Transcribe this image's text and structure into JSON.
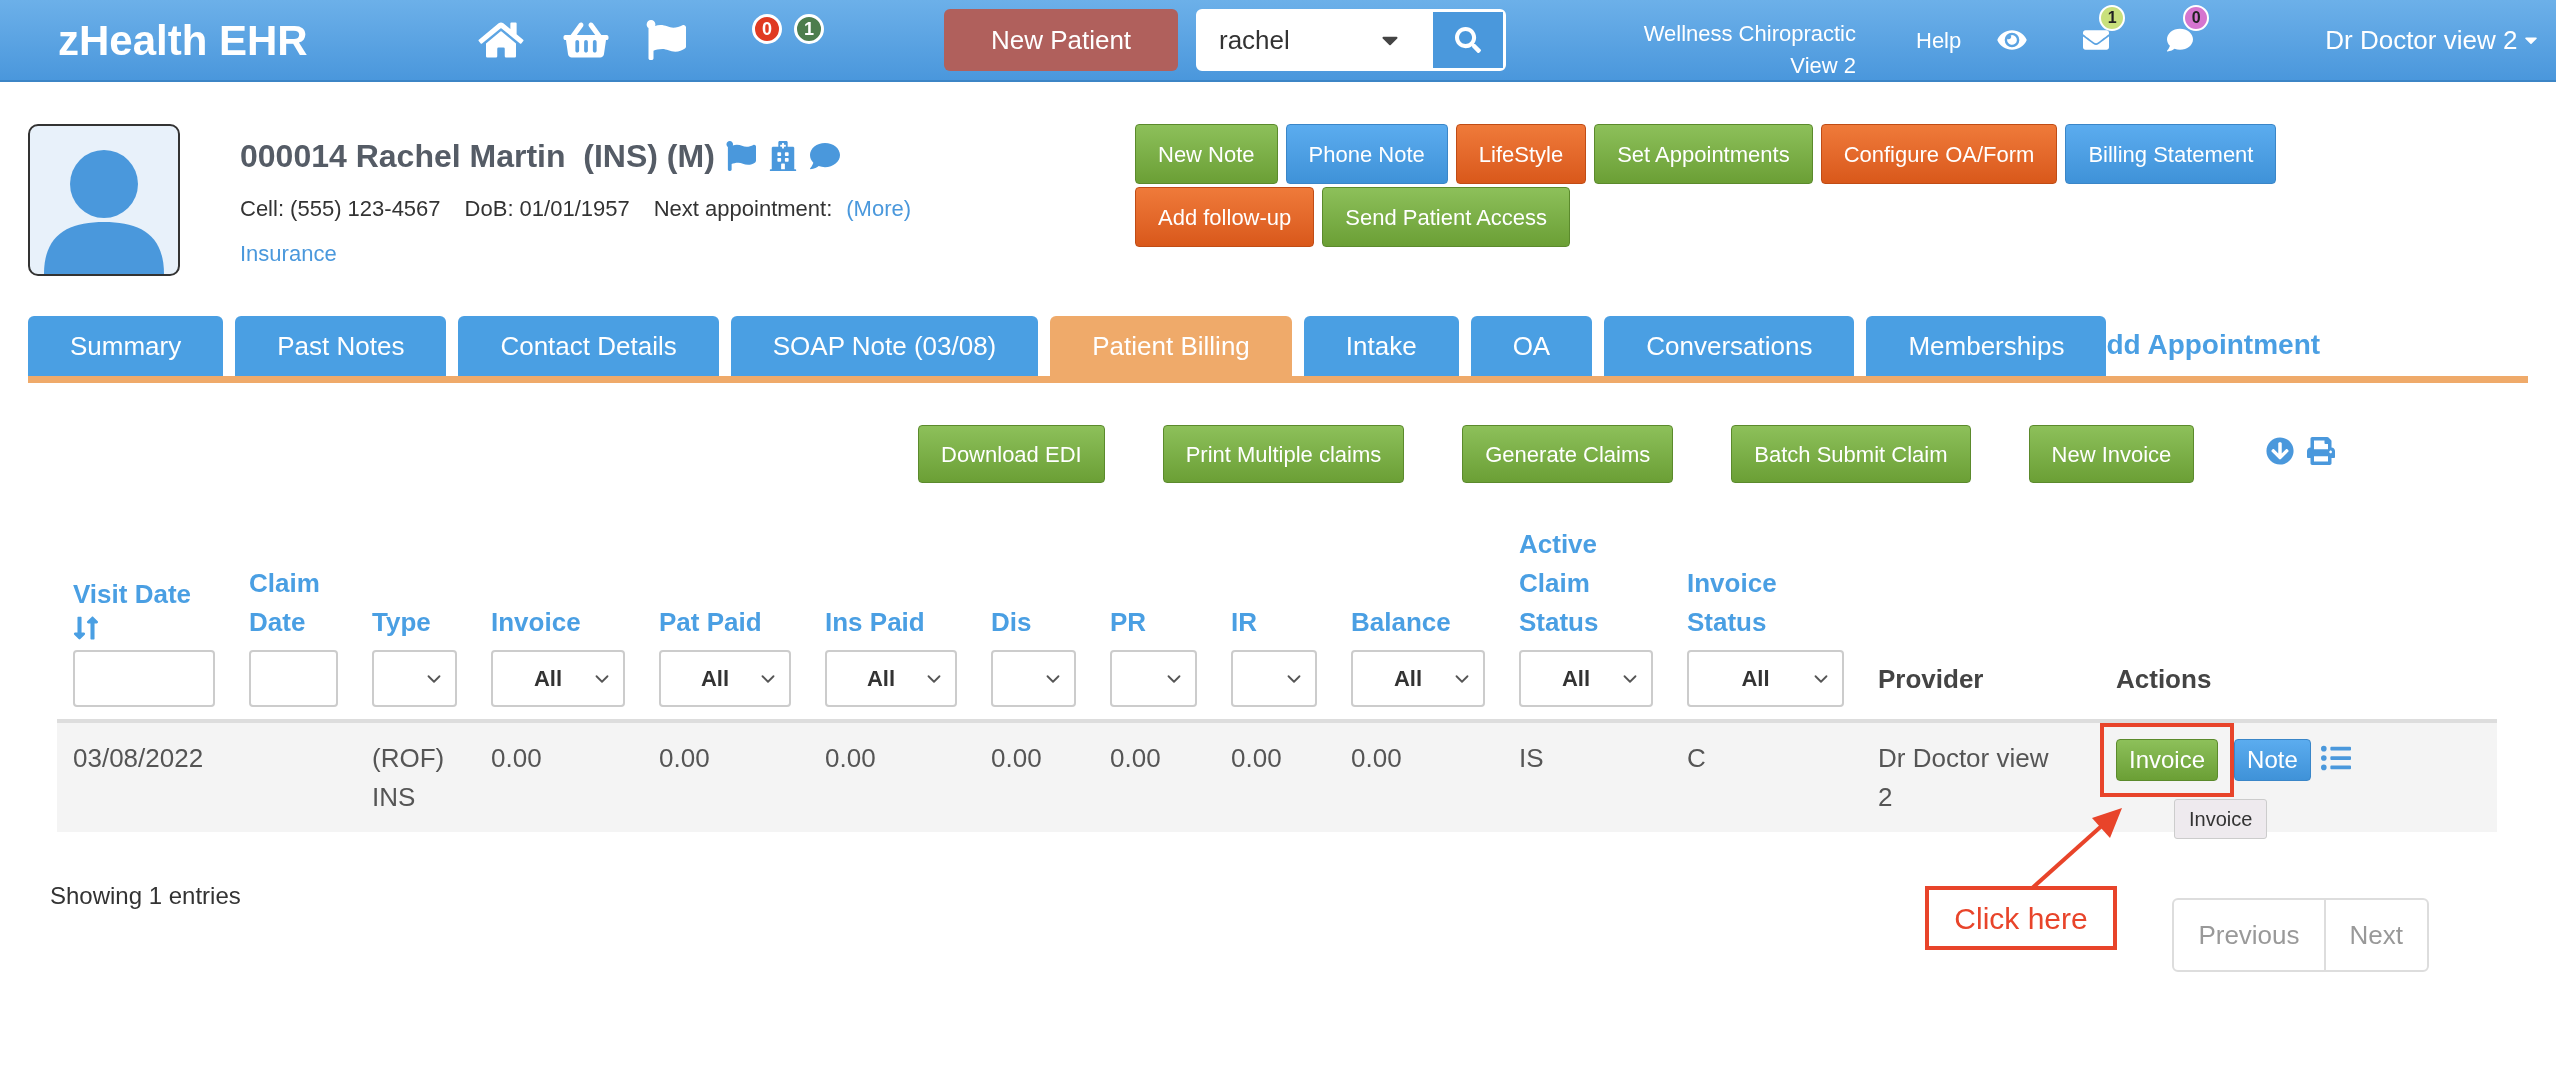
{
  "header": {
    "app_title": "zHealth EHR",
    "counters": [
      {
        "count": "0",
        "color": "#e03a22"
      },
      {
        "count": "1",
        "color": "#4d7d4d"
      }
    ],
    "new_patient_button": "New Patient",
    "search": {
      "value": "rachel"
    },
    "clinic": "Wellness Chiropractic View 2",
    "help": "Help",
    "notifications": [
      {
        "kind": "mail",
        "count": "1",
        "color": "#c9e07c"
      },
      {
        "kind": "chat",
        "count": "0",
        "color": "#d575cf"
      }
    ],
    "user_menu": "Dr Doctor view 2"
  },
  "patient": {
    "title": "000014 Rachel Martin  (INS) (M)",
    "details": [
      "Cell: (555) 123-4567",
      "DoB: 01/01/1957",
      "Next appointment:"
    ],
    "more_link": "(More)",
    "insurance_link": "Insurance"
  },
  "action_buttons": [
    [
      {
        "label": "New Note",
        "kind": "green"
      },
      {
        "label": "Phone Note",
        "kind": "blue"
      },
      {
        "label": "LifeStyle",
        "kind": "orange"
      },
      {
        "label": "Set Appointments",
        "kind": "green"
      },
      {
        "label": "Configure OA/Form",
        "kind": "orange"
      },
      {
        "label": "Billing Statement",
        "kind": "blue"
      }
    ],
    [
      {
        "label": "Add follow-up",
        "kind": "orange"
      },
      {
        "label": "Send Patient Access",
        "kind": "green"
      }
    ]
  ],
  "tabs": [
    {
      "label": "Summary",
      "selected": false
    },
    {
      "label": "Past Notes",
      "selected": false
    },
    {
      "label": "Contact Details",
      "selected": false
    },
    {
      "label": "SOAP Note (03/08)",
      "selected": false
    },
    {
      "label": "Patient Billing",
      "selected": true
    },
    {
      "label": "Intake",
      "selected": false
    },
    {
      "label": "OA",
      "selected": false
    },
    {
      "label": "Conversations",
      "selected": false
    },
    {
      "label": "Memberships",
      "selected": false
    }
  ],
  "partly_hidden_link": "dd Appointment",
  "billing_toolbar": [
    "Download EDI",
    "Print Multiple claims",
    "Generate Claims",
    "Batch Submit Claim",
    "New Invoice"
  ],
  "table": {
    "columns": [
      {
        "label": "Visit Date",
        "sortable": true,
        "filter": {
          "kind": "text"
        }
      },
      {
        "label": "Claim Date",
        "sortable": false,
        "filter": {
          "kind": "text"
        }
      },
      {
        "label": "Type",
        "sortable": false,
        "filter": {
          "kind": "select"
        }
      },
      {
        "label": "Invoice",
        "sortable": false,
        "filter": {
          "kind": "select",
          "value": "All"
        }
      },
      {
        "label": "Pat Paid",
        "sortable": false,
        "filter": {
          "kind": "select",
          "value": "All"
        }
      },
      {
        "label": "Ins Paid",
        "sortable": false,
        "filter": {
          "kind": "select",
          "value": "All"
        }
      },
      {
        "label": "Dis",
        "sortable": false,
        "filter": {
          "kind": "select"
        }
      },
      {
        "label": "PR",
        "sortable": false,
        "filter": {
          "kind": "select"
        }
      },
      {
        "label": "IR",
        "sortable": false,
        "filter": {
          "kind": "select"
        }
      },
      {
        "label": "Balance",
        "sortable": false,
        "filter": {
          "kind": "select",
          "value": "All"
        }
      },
      {
        "label": "Active Claim Status",
        "sortable": false,
        "filter": {
          "kind": "select",
          "value": "All"
        }
      },
      {
        "label": "Invoice Status",
        "sortable": false,
        "filter": {
          "kind": "select",
          "value": "All"
        }
      },
      {
        "label": "Provider",
        "sortable": false,
        "filter": {
          "kind": "none"
        }
      },
      {
        "label": "Actions",
        "sortable": false,
        "filter": {
          "kind": "none"
        }
      }
    ],
    "rows": [
      {
        "visit_date": "03/08/2022",
        "type": "(ROF) INS",
        "invoice": "0.00",
        "pat_paid": "0.00",
        "ins_paid": "0.00",
        "dis": "0.00",
        "pr": "0.00",
        "ir": "0.00",
        "balance": "0.00",
        "active_claim_status": "IS",
        "invoice_status": "C",
        "provider": "Dr Doctor view 2",
        "actions": [
          {
            "label": "Invoice",
            "kind": "green",
            "highlighted": true
          },
          {
            "label": "Note",
            "kind": "blue",
            "highlighted": false
          }
        ],
        "tooltip": "Invoice"
      }
    ]
  },
  "footer": {
    "entries_info": "Showing 1 entries",
    "pagination": [
      "Previous",
      "Next"
    ]
  },
  "annotation": {
    "callout": "Click here"
  }
}
